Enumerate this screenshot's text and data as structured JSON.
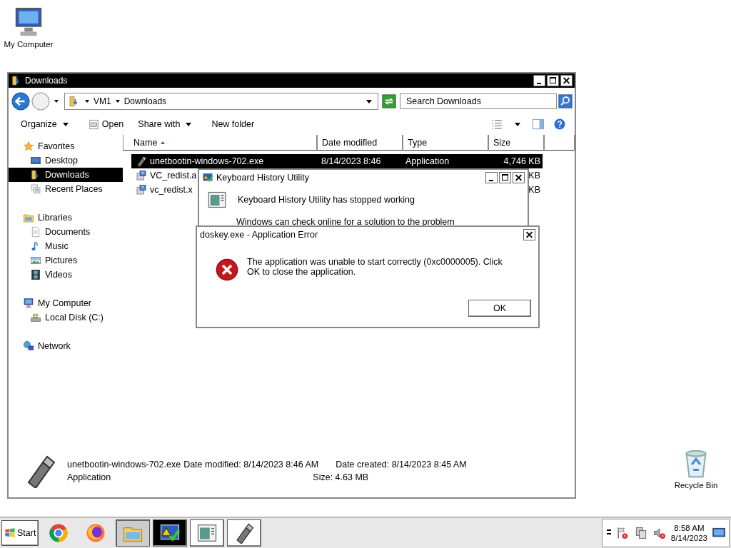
{
  "desktop_icons": [
    {
      "label": "My Computer",
      "kind": "computer"
    },
    {
      "label": "Recycle Bin",
      "kind": "recycle"
    }
  ],
  "explorer": {
    "title": "Downloads",
    "breadcrumb": [
      "VM1",
      "Downloads"
    ],
    "search": {
      "placeholder": "Search Downloads"
    },
    "toolbar": [
      {
        "label": "Organize",
        "kind": "menu"
      },
      {
        "label": "Open",
        "kind": "open"
      },
      {
        "label": "Share with",
        "kind": "menu"
      },
      {
        "label": "New folder",
        "kind": "plain"
      }
    ],
    "sidebar": [
      {
        "label": "Favorites",
        "kind": "star",
        "children": [
          {
            "label": "Desktop",
            "kind": "desktop",
            "selected": false
          },
          {
            "label": "Downloads",
            "kind": "downloads",
            "selected": true
          },
          {
            "label": "Recent Places",
            "kind": "recent",
            "selected": false
          }
        ]
      },
      {
        "label": "Libraries",
        "kind": "library",
        "children": [
          {
            "label": "Documents",
            "kind": "document",
            "selected": false
          },
          {
            "label": "Music",
            "kind": "music",
            "selected": false
          },
          {
            "label": "Pictures",
            "kind": "pictures",
            "selected": false
          },
          {
            "label": "Videos",
            "kind": "video",
            "selected": false
          }
        ]
      },
      {
        "label": "My Computer",
        "kind": "computer",
        "children": [
          {
            "label": "Local Disk (C:)",
            "kind": "disk",
            "selected": false
          }
        ]
      },
      {
        "label": "Network",
        "kind": "network"
      }
    ],
    "columns": [
      {
        "label": "Name",
        "sorted": true
      },
      {
        "label": "Date modified",
        "sorted": false
      },
      {
        "label": "Type",
        "sorted": false
      },
      {
        "label": "Size",
        "sorted": false
      }
    ],
    "files": [
      {
        "name": "unetbootin-windows-702.exe",
        "date": "8/14/2023 8:46",
        "type": "Application",
        "size": "4,746 KB",
        "kind": "usb",
        "selected": true
      },
      {
        "name": "VC_redist.a",
        "size": "KB",
        "kind": "installer",
        "selected": false
      },
      {
        "name": "vc_redist.x",
        "size": "KB",
        "kind": "installer",
        "selected": false
      }
    ],
    "details": {
      "name": "unetbootin-windows-702.exe",
      "type": "Application",
      "modified": "Date modified: 8/14/2023 8:46 AM",
      "created": "Date created: 8/14/2023 8:45 AM",
      "size": "Size: 4.63 MB"
    }
  },
  "stopped_dialog": {
    "title": "Keyboard History Utility",
    "message": "Keyboard History Utility has stopped working",
    "detail": "Windows can check online for a solution to the problem"
  },
  "error_dialog": {
    "title": "doskey.exe - Application Error",
    "message": "The application was unable to start correctly (0xc0000005). Click OK to close the application.",
    "button": "OK"
  },
  "taskbar": {
    "start": "Start",
    "apps": [
      {
        "kind": "chrome",
        "selected": false
      },
      {
        "kind": "firefox",
        "selected": false
      },
      {
        "kind": "folder",
        "selected": true
      },
      {
        "kind": "shield",
        "selected": false,
        "active": true
      },
      {
        "kind": "window",
        "selected": false
      },
      {
        "kind": "usb",
        "selected": false
      }
    ],
    "tray": [
      {
        "kind": "flag"
      },
      {
        "kind": "network"
      },
      {
        "kind": "speaker"
      }
    ],
    "time": "8:58 AM",
    "date": "8/14/2023"
  }
}
